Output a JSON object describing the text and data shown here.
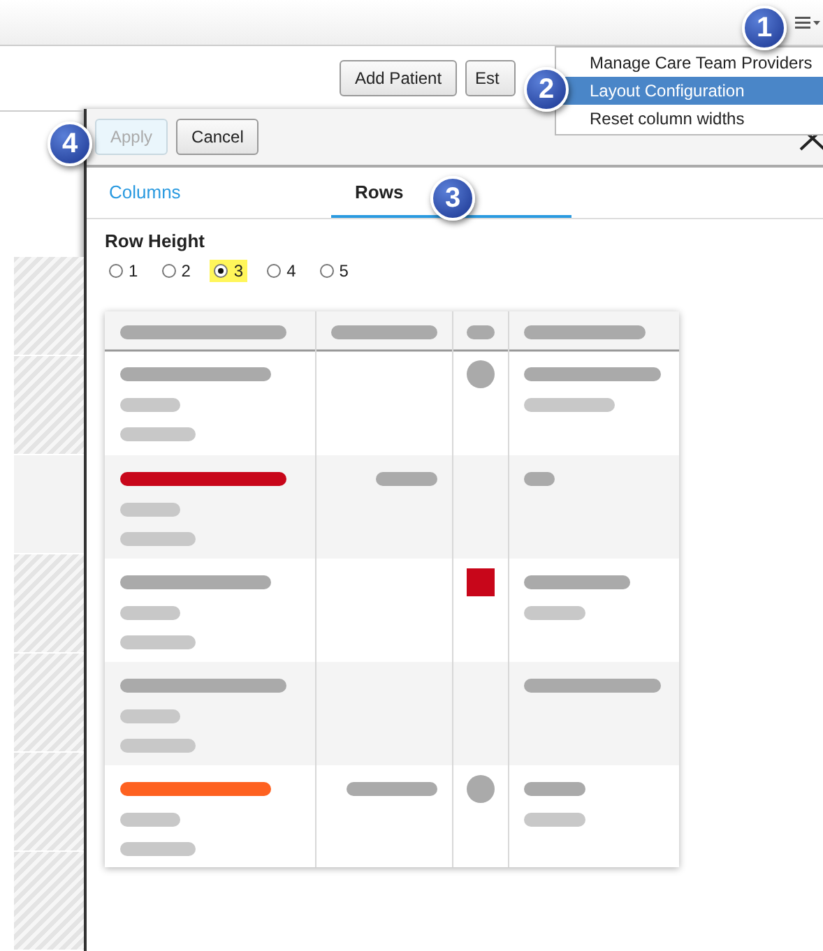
{
  "callouts": [
    "1",
    "2",
    "3",
    "4"
  ],
  "actions": [
    {
      "label": "Add Patient"
    },
    {
      "label": "Est"
    }
  ],
  "menu": {
    "items": [
      {
        "label": "Manage Care Team Providers",
        "selected": false
      },
      {
        "label": "Layout Configuration",
        "selected": true
      },
      {
        "label": "Reset column widths",
        "selected": false
      }
    ]
  },
  "dialog": {
    "buttons": [
      {
        "label": "Apply",
        "disabled": true
      },
      {
        "label": "Cancel",
        "disabled": false
      }
    ],
    "tabs": [
      {
        "label": "Columns",
        "selected": false
      },
      {
        "label": "Rows",
        "selected": true
      }
    ],
    "row_height": {
      "label": "Row Height",
      "options": [
        {
          "label": "1",
          "selected": false
        },
        {
          "label": "2",
          "selected": false
        },
        {
          "label": "3",
          "selected": true
        },
        {
          "label": "4",
          "selected": false
        },
        {
          "label": "5",
          "selected": false
        }
      ]
    }
  }
}
